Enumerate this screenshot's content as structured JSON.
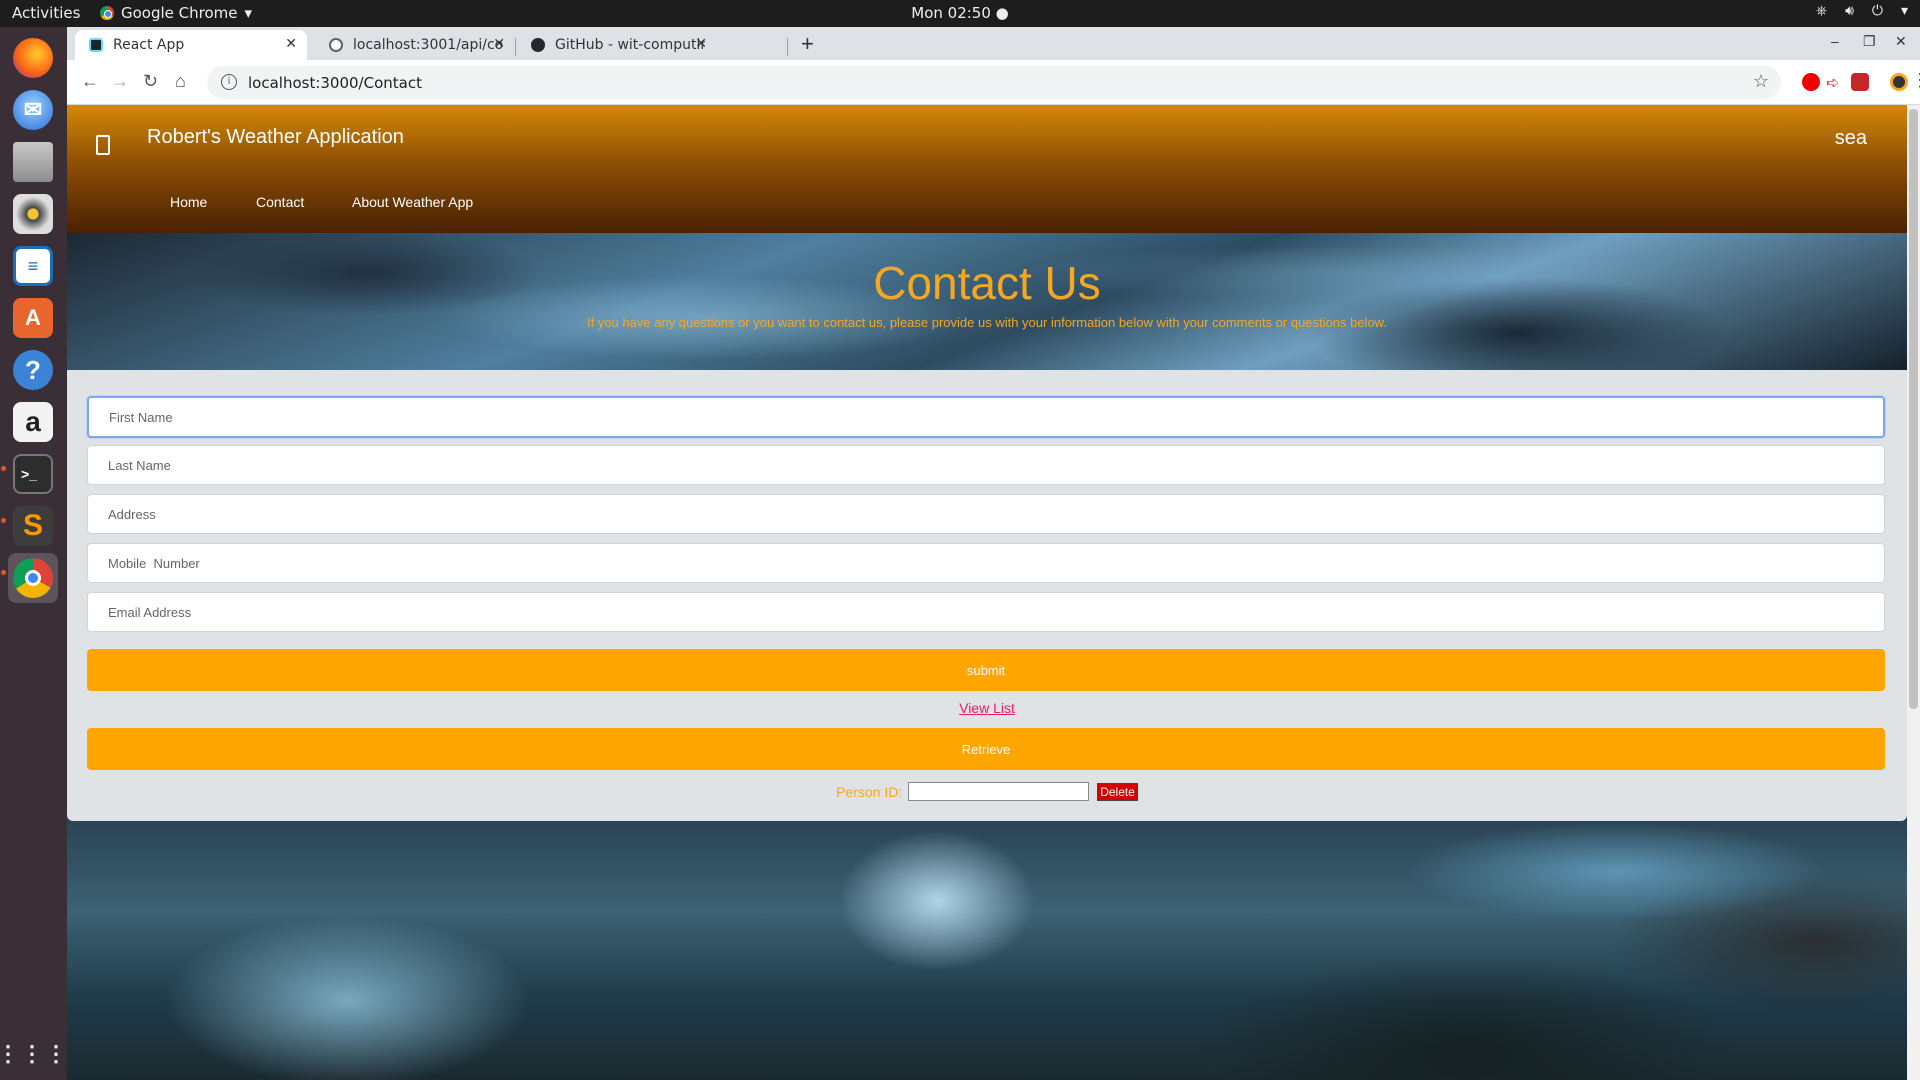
{
  "gnome": {
    "activities": "Activities",
    "app_name": "Google Chrome",
    "clock": "Mon 02:50"
  },
  "browser": {
    "tabs": [
      {
        "title": "React App",
        "favicon_color": "#20232a"
      },
      {
        "title": "localhost:3001/api/conta",
        "favicon_color": "#5f6368"
      },
      {
        "title": "GitHub - wit-computing/v",
        "favicon_color": "#24292e"
      }
    ],
    "url": "localhost:3000/Contact"
  },
  "site": {
    "title": "Robert's Weather Application",
    "search_label": "sea",
    "nav": {
      "home": "Home",
      "contact": "Contact",
      "about": "About Weather App"
    }
  },
  "hero": {
    "title": "Contact Us",
    "subtitle": "If you have any questions or you want to contact us, please provide us with your information below with your comments or questions below."
  },
  "form": {
    "first_name_placeholder": "First Name",
    "last_name_placeholder": "Last Name",
    "address_placeholder": "Address",
    "mobile_placeholder": "Mobile  Number",
    "email_placeholder": "Email Address",
    "submit_label": "submit",
    "view_list_label": "View List",
    "retrieve_label": "Retrieve",
    "person_id_label": "Person ID:",
    "delete_label": "Delete"
  },
  "colors": {
    "accent_orange": "#ffa500",
    "title_orange": "#f5a623",
    "delete_red": "#d40000",
    "link_pink": "#e91e63"
  }
}
